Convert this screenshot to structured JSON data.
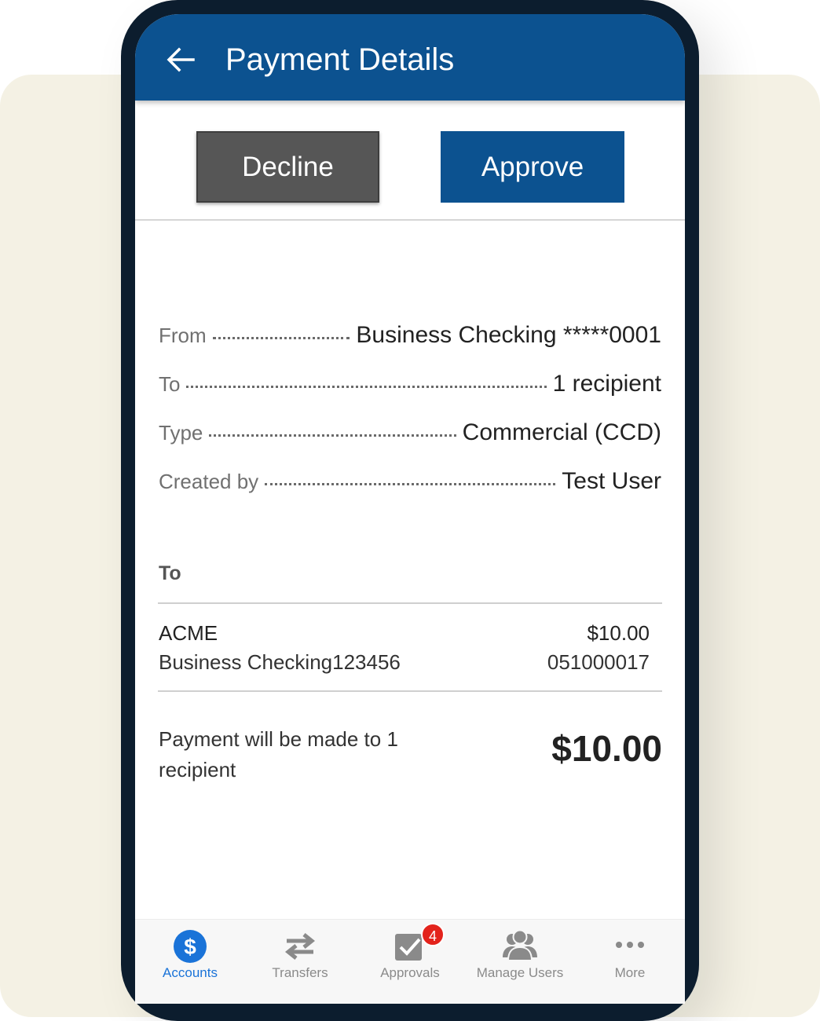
{
  "header": {
    "title": "Payment Details"
  },
  "actions": {
    "decline_label": "Decline",
    "approve_label": "Approve"
  },
  "details": {
    "from_label": "From",
    "from_value": "Business Checking *****0001",
    "to_label": "To",
    "to_value": "1 recipient",
    "type_label": "Type",
    "type_value": "Commercial (CCD)",
    "created_by_label": "Created by",
    "created_by_value": "Test User"
  },
  "recipients": {
    "section_title": "To",
    "items": [
      {
        "name": "ACME",
        "account": "Business Checking123456",
        "amount": "$10.00",
        "routing": "051000017"
      }
    ]
  },
  "summary": {
    "text": "Payment will be made to 1 recipient",
    "total": "$10.00"
  },
  "nav": {
    "items": [
      {
        "label": "Accounts",
        "icon": "dollar-icon",
        "active": true
      },
      {
        "label": "Transfers",
        "icon": "transfer-arrows-icon"
      },
      {
        "label": "Approvals",
        "icon": "approval-check-icon",
        "badge": "4"
      },
      {
        "label": "Manage Users",
        "icon": "users-icon"
      },
      {
        "label": "More",
        "icon": "more-dots-icon"
      }
    ]
  },
  "colors": {
    "brand_blue": "#0c5290",
    "decline_gray": "#565656",
    "active_nav": "#1a73d8",
    "badge_red": "#e3231c"
  }
}
